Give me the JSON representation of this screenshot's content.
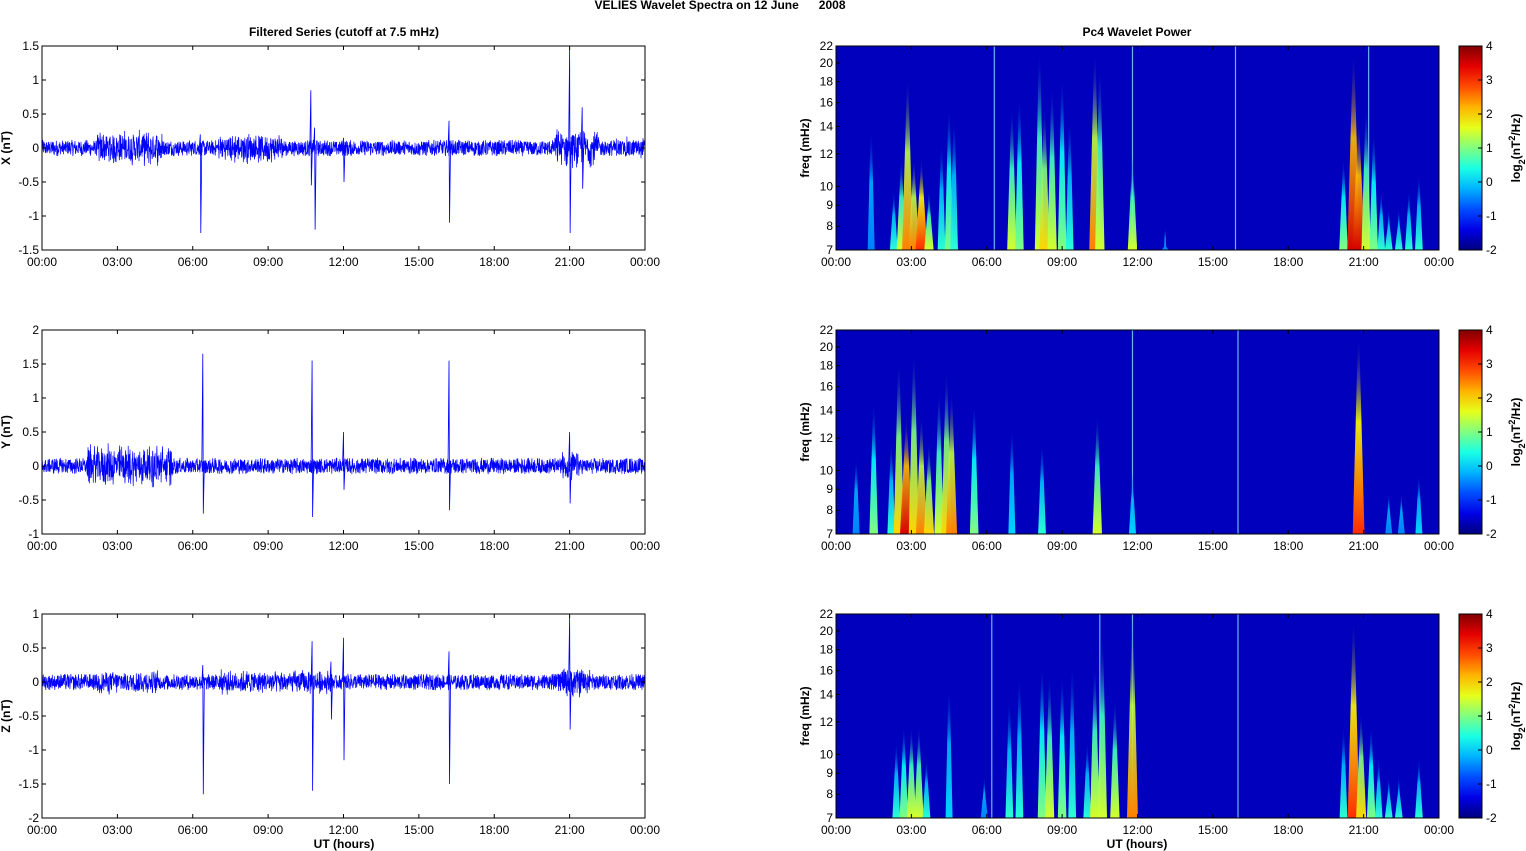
{
  "chart_data": {
    "title": "VELIES Wavelet Spectra on 12 June      2008",
    "xticks": [
      "00:00",
      "03:00",
      "06:00",
      "09:00",
      "12:00",
      "15:00",
      "18:00",
      "21:00",
      "00:00"
    ],
    "xlim_hours": [
      0,
      24
    ],
    "xlabel": "UT (hours)",
    "series_color": "#0000ff",
    "left_title": "Filtered Series (cutoff at 7.5 mHz)",
    "right_title": "Pc4 Wavelet Power",
    "panels": [
      {
        "type": "line",
        "ylabel": "X (nT)",
        "ylim": [
          -1.5,
          1.5
        ],
        "yticks": [
          -1.5,
          -1,
          -0.5,
          0,
          0.5,
          1,
          1.5
        ],
        "base_noise": 0.12,
        "noise_segments": [
          [
            2.2,
            4.8,
            0.28
          ],
          [
            7.0,
            9.6,
            0.25
          ],
          [
            20.4,
            22.2,
            0.3
          ],
          [
            22.8,
            24,
            0.18
          ]
        ],
        "spikes": [
          [
            6.3,
            0.2,
            -1.25
          ],
          [
            10.7,
            0.85,
            -0.55
          ],
          [
            10.85,
            0.3,
            -1.2
          ],
          [
            12.0,
            0.15,
            -0.5
          ],
          [
            16.2,
            0.4,
            -1.1
          ],
          [
            21.0,
            1.45,
            -1.25
          ],
          [
            21.5,
            0.6,
            -0.6
          ]
        ]
      },
      {
        "type": "line",
        "ylabel": "Y (nT)",
        "ylim": [
          -1,
          2
        ],
        "yticks": [
          -1,
          -0.5,
          0,
          0.5,
          1,
          1.5,
          2
        ],
        "base_noise": 0.12,
        "noise_segments": [
          [
            1.8,
            5.2,
            0.35
          ],
          [
            20.6,
            21.4,
            0.25
          ]
        ],
        "spikes": [
          [
            6.4,
            1.65,
            -0.7
          ],
          [
            10.75,
            1.55,
            -0.75
          ],
          [
            12.0,
            0.5,
            -0.35
          ],
          [
            16.2,
            1.55,
            -0.65
          ],
          [
            21.0,
            0.5,
            -0.55
          ]
        ]
      },
      {
        "type": "line",
        "ylabel": "Z (nT)",
        "ylim": [
          -2,
          1
        ],
        "yticks": [
          -2,
          -1.5,
          -1,
          -0.5,
          0,
          0.5,
          1
        ],
        "base_noise": 0.12,
        "noise_segments": [
          [
            2.2,
            4.6,
            0.2
          ],
          [
            7.0,
            11.5,
            0.2
          ],
          [
            20.5,
            21.8,
            0.25
          ]
        ],
        "spikes": [
          [
            6.4,
            0.25,
            -1.65
          ],
          [
            10.75,
            0.6,
            -1.6
          ],
          [
            11.5,
            0.3,
            -0.55
          ],
          [
            12.0,
            0.65,
            -1.15
          ],
          [
            16.2,
            0.45,
            -1.5
          ],
          [
            21.0,
            0.95,
            -0.7
          ]
        ]
      }
    ],
    "spectra": [
      {
        "type": "heatmap",
        "ylabel": "freq (mHz)",
        "yticks": [
          7,
          8,
          9,
          10,
          12,
          14,
          16,
          18,
          20,
          22
        ],
        "ylim": [
          7,
          22
        ],
        "yscale": "log",
        "clim": [
          -2,
          4
        ],
        "bursts": [
          [
            1.4,
            14,
            -0.5
          ],
          [
            2.3,
            10,
            0.5
          ],
          [
            2.6,
            12,
            1.5
          ],
          [
            2.85,
            19,
            2.5
          ],
          [
            3.1,
            12,
            2.5
          ],
          [
            3.4,
            12,
            3
          ],
          [
            3.7,
            10,
            1.5
          ],
          [
            4.2,
            13,
            0.5
          ],
          [
            4.5,
            16,
            1
          ],
          [
            4.7,
            15,
            0.5
          ],
          [
            7.0,
            16,
            1.5
          ],
          [
            7.3,
            17,
            1
          ],
          [
            8.1,
            22,
            1.5
          ],
          [
            8.3,
            16,
            2
          ],
          [
            8.6,
            18,
            1.5
          ],
          [
            9.0,
            19,
            1
          ],
          [
            9.3,
            15,
            0.5
          ],
          [
            10.3,
            22,
            2.5
          ],
          [
            10.5,
            20,
            1.5
          ],
          [
            11.8,
            12,
            1.5
          ],
          [
            13.1,
            8,
            -0.5
          ],
          [
            20.2,
            12,
            1
          ],
          [
            20.6,
            22,
            3.5
          ],
          [
            20.8,
            15,
            3.5
          ],
          [
            21.1,
            16,
            1.5
          ],
          [
            21.4,
            14,
            1
          ],
          [
            21.7,
            10,
            0.5
          ],
          [
            22.0,
            9,
            0.5
          ],
          [
            22.4,
            9,
            0.5
          ],
          [
            22.8,
            10,
            0.5
          ],
          [
            23.2,
            11,
            0.5
          ]
        ],
        "lines": [
          6.3,
          11.8,
          15.9,
          21.2
        ]
      },
      {
        "type": "heatmap",
        "ylabel": "freq (mHz)",
        "yticks": [
          7,
          8,
          9,
          10,
          12,
          14,
          16,
          18,
          20,
          22
        ],
        "ylim": [
          7,
          22
        ],
        "yscale": "log",
        "clim": [
          -2,
          4
        ],
        "bursts": [
          [
            0.8,
            11,
            -0.5
          ],
          [
            1.5,
            15,
            1
          ],
          [
            2.2,
            12,
            0.5
          ],
          [
            2.5,
            19,
            2
          ],
          [
            2.8,
            14,
            3.5
          ],
          [
            3.1,
            20,
            2
          ],
          [
            3.4,
            14,
            2.5
          ],
          [
            3.7,
            12,
            2
          ],
          [
            4.1,
            16,
            1.5
          ],
          [
            4.4,
            18,
            2
          ],
          [
            4.6,
            16,
            2.5
          ],
          [
            5.5,
            15,
            1
          ],
          [
            7.0,
            13,
            0
          ],
          [
            8.2,
            12,
            0.5
          ],
          [
            10.4,
            14,
            1.5
          ],
          [
            11.8,
            10,
            0
          ],
          [
            20.8,
            22,
            3
          ],
          [
            22.0,
            9,
            -0.5
          ],
          [
            22.5,
            9,
            -0.5
          ],
          [
            23.2,
            10,
            0
          ]
        ],
        "lines": [
          11.8,
          16.0
        ]
      },
      {
        "type": "heatmap",
        "ylabel": "freq (mHz)",
        "yticks": [
          7,
          8,
          9,
          10,
          12,
          14,
          16,
          18,
          20,
          22
        ],
        "ylim": [
          7,
          22
        ],
        "yscale": "log",
        "clim": [
          -2,
          4
        ],
        "bursts": [
          [
            2.4,
            11,
            0.5
          ],
          [
            2.7,
            12,
            1
          ],
          [
            3.0,
            12,
            1.5
          ],
          [
            3.3,
            12,
            1.5
          ],
          [
            3.6,
            10,
            0.5
          ],
          [
            4.5,
            15,
            0
          ],
          [
            5.9,
            9,
            -0.5
          ],
          [
            6.9,
            14,
            0.5
          ],
          [
            7.3,
            16,
            0.5
          ],
          [
            8.2,
            17,
            1
          ],
          [
            8.5,
            16,
            1.5
          ],
          [
            9.0,
            16,
            1
          ],
          [
            9.4,
            17,
            0.5
          ],
          [
            10.0,
            11,
            0.5
          ],
          [
            10.3,
            17,
            1.5
          ],
          [
            10.6,
            20,
            1.5
          ],
          [
            11.1,
            14,
            1.5
          ],
          [
            11.8,
            22,
            2.5
          ],
          [
            20.2,
            12,
            0.5
          ],
          [
            20.6,
            22,
            3
          ],
          [
            20.9,
            13,
            2
          ],
          [
            21.3,
            12,
            1
          ],
          [
            21.6,
            10,
            0.5
          ],
          [
            22.0,
            9,
            0.5
          ],
          [
            22.4,
            9,
            0.5
          ],
          [
            23.2,
            10,
            0.5
          ]
        ],
        "lines": [
          6.2,
          10.5,
          11.8,
          16.0
        ]
      }
    ],
    "colorbar": {
      "ticks": [
        -2,
        -1,
        0,
        1,
        2,
        3,
        4
      ],
      "label_parts": [
        "log",
        "2",
        "(nT",
        "2",
        "/Hz)"
      ]
    }
  }
}
